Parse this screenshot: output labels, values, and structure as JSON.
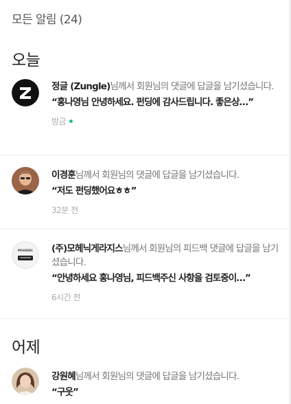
{
  "header": {
    "title": "모든 알림 (24)"
  },
  "sections": [
    {
      "label": "오늘"
    },
    {
      "label": "어제"
    }
  ],
  "notifications": [
    {
      "name": "정글 (Zungle)",
      "message": "님께서 회원님의 댓글에 답글을 남기셨습니다.",
      "quote": "“홍나영님 안녕하세요. 펀딩에 감사드립니다. 좋은상…”",
      "time": "방금",
      "unread": true
    },
    {
      "name": "이경훈",
      "message": "님께서 회원님의 댓글에 답글을 남기셨습니다.",
      "quote": "“저도 펀딩했어요ㅎㅎ”",
      "time": "32분 전",
      "unread": false
    },
    {
      "name": "(주)모헤닉게라지스",
      "message": "님께서 회원님의 피드백 댓글에 답글을 남기셨습니다.",
      "quote": "“안녕하세요 홍나영님, 피드백주신 사항을 검토중이…”",
      "time": "6시간 전",
      "unread": false
    },
    {
      "name": "강원혜",
      "message": "님께서 회원님의 댓글에 답글을 남기셨습니다.",
      "quote": "“구웃”",
      "time": "",
      "unread": false
    }
  ],
  "avatars": {
    "zungle_logo_text": "Z",
    "mohenic_logo_text": "MOHENIC"
  },
  "colors": {
    "unread_dot": "#22c17c",
    "name": "#222222",
    "message": "#777777",
    "time": "#aaaaaa"
  }
}
